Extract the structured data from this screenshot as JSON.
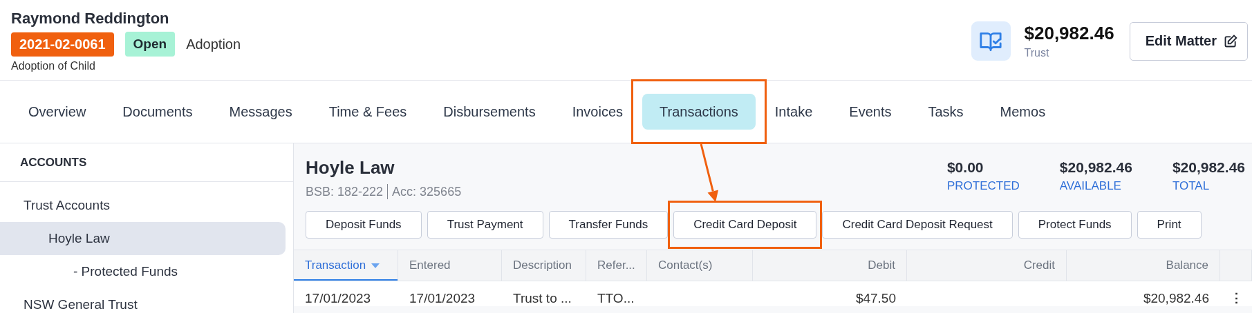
{
  "matter": {
    "client": "Raymond Reddington",
    "number": "2021-02-0061",
    "status": "Open",
    "type": "Adoption",
    "description": "Adoption of Child"
  },
  "trust_summary": {
    "amount": "$20,982.46",
    "label": "Trust"
  },
  "edit_button": {
    "label": "Edit Matter"
  },
  "tabs": [
    {
      "label": "Overview",
      "selected": false,
      "highlighted": false
    },
    {
      "label": "Documents",
      "selected": false,
      "highlighted": false
    },
    {
      "label": "Messages",
      "selected": false,
      "highlighted": false
    },
    {
      "label": "Time & Fees",
      "selected": false,
      "highlighted": false
    },
    {
      "label": "Disbursements",
      "selected": false,
      "highlighted": false
    },
    {
      "label": "Invoices",
      "selected": false,
      "highlighted": false
    },
    {
      "label": "Transactions",
      "selected": true,
      "highlighted": true
    },
    {
      "label": "Intake",
      "selected": false,
      "highlighted": false
    },
    {
      "label": "Events",
      "selected": false,
      "highlighted": false
    },
    {
      "label": "Tasks",
      "selected": false,
      "highlighted": false
    },
    {
      "label": "Memos",
      "selected": false,
      "highlighted": false
    }
  ],
  "sidebar": {
    "heading": "ACCOUNTS",
    "items": [
      {
        "label": "Trust Accounts",
        "selected": false,
        "children": [
          {
            "label": "Hoyle Law",
            "selected": true,
            "children": [
              {
                "label": "- Protected Funds",
                "selected": false
              }
            ]
          }
        ]
      },
      {
        "label": "NSW General Trust",
        "selected": false
      }
    ]
  },
  "account": {
    "name": "Hoyle Law",
    "bsb": "BSB: 182-222",
    "acc": "Acc: 325665",
    "stats": [
      {
        "value": "$0.00",
        "label": "PROTECTED"
      },
      {
        "value": "$20,982.46",
        "label": "AVAILABLE"
      },
      {
        "value": "$20,982.46",
        "label": "TOTAL"
      }
    ],
    "actions": [
      {
        "label": "Deposit Funds",
        "highlighted": false
      },
      {
        "label": "Trust Payment",
        "highlighted": false
      },
      {
        "label": "Transfer Funds",
        "highlighted": false
      },
      {
        "label": "Credit Card Deposit",
        "highlighted": true
      },
      {
        "label": "Credit Card Deposit Request",
        "highlighted": false
      },
      {
        "label": "Protect Funds",
        "highlighted": false
      },
      {
        "label": "Print",
        "highlighted": false
      }
    ]
  },
  "table": {
    "columns": [
      {
        "label": "Transaction",
        "sorted": true,
        "kind": "text"
      },
      {
        "label": "Entered",
        "sorted": false,
        "kind": "text"
      },
      {
        "label": "Description",
        "sorted": false,
        "kind": "text"
      },
      {
        "label": "Refer...",
        "sorted": false,
        "kind": "text"
      },
      {
        "label": "Contact(s)",
        "sorted": false,
        "kind": "text"
      },
      {
        "label": "Debit",
        "sorted": false,
        "kind": "amount"
      },
      {
        "label": "Credit",
        "sorted": false,
        "kind": "amount"
      },
      {
        "label": "Balance",
        "sorted": false,
        "kind": "amount"
      }
    ],
    "rows": [
      {
        "cells": [
          "17/01/2023",
          "17/01/2023",
          "Trust to ...",
          "TTO...",
          "",
          "$47.50",
          "",
          "$20,982.46"
        ],
        "menu": "⋮"
      }
    ]
  }
}
